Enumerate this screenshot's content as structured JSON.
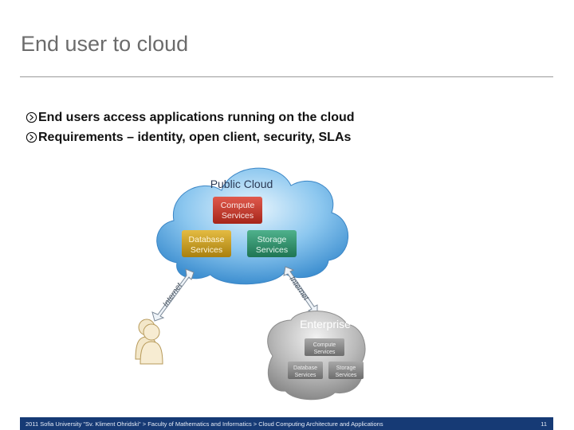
{
  "slide": {
    "title": "End user to cloud",
    "bullets": [
      "End users access applications running on the cloud",
      "Requirements – identity, open client, security, SLAs"
    ]
  },
  "diagram": {
    "public_cloud": {
      "title": "Public Cloud",
      "compute_l1": "Compute",
      "compute_l2": "Services",
      "database_l1": "Database",
      "database_l2": "Services",
      "storage_l1": "Storage",
      "storage_l2": "Services"
    },
    "enterprise": {
      "title": "Enterprise",
      "compute_l1": "Compute",
      "compute_l2": "Services",
      "database_l1": "Database",
      "database_l2": "Services",
      "storage_l1": "Storage",
      "storage_l2": "Services"
    },
    "link_left": "Internet",
    "link_right": "Internet",
    "colors": {
      "cloud_blue": "#4f9fdd",
      "compute_red": "#c0392b",
      "database_gold": "#c79a1c",
      "storage_green": "#2f8f6a",
      "footer_navy": "#163a75"
    }
  },
  "footer": {
    "text": "2011 Sofia University \"Sv. Kliment Ohridski\" > Faculty of Mathematics and Informatics > Cloud Computing Architecture and Applications",
    "page_number": "11"
  }
}
